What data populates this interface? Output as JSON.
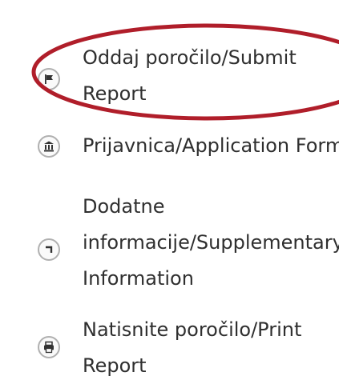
{
  "menu": {
    "items": [
      {
        "label_line1": "Oddaj poročilo/Submit",
        "label_line2": "Report",
        "icon": "flag-icon"
      },
      {
        "label_line1": "Prijavnica/Application Form",
        "icon": "building-icon"
      },
      {
        "label_line1": "Dodatne",
        "label_line2": "informacije/Supplementary",
        "label_line3": "Information",
        "icon": "corner-arrow-icon"
      },
      {
        "label_line1": "Natisnite poročilo/Print",
        "label_line2": "Report",
        "icon": "printer-icon"
      }
    ]
  },
  "colors": {
    "highlight": "#b01e2a",
    "text": "#2f2f2f",
    "icon_border": "#b0b0b0",
    "icon_glyph": "#333333"
  }
}
